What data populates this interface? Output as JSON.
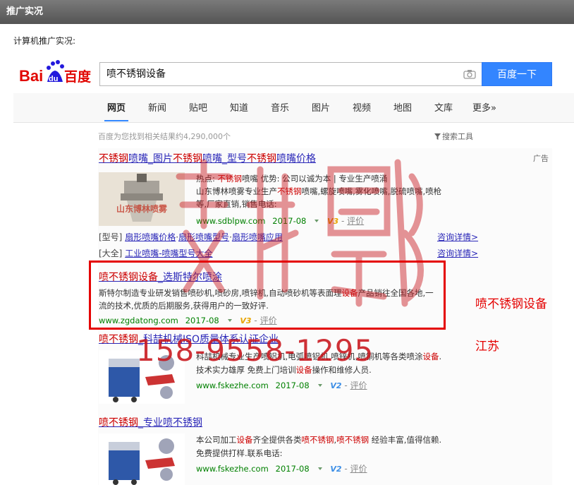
{
  "header": {
    "title": "推广实况"
  },
  "subtitle": "计算机推广实况:",
  "search": {
    "logo": {
      "text1": "Bai",
      "text2": "du",
      "text3": "百度"
    },
    "query": "喷不锈钢设备",
    "button": "百度一下"
  },
  "tabs": [
    "网页",
    "新闻",
    "贴吧",
    "知道",
    "音乐",
    "图片",
    "视频",
    "地图",
    "文库",
    "更多»"
  ],
  "stats": "百度为您找到相关结果约4,290,000个",
  "tools": "搜索工具",
  "ad_tag": "广告",
  "results": [
    {
      "title_parts": [
        "不锈钢",
        "喷嘴_图片",
        "不锈钢",
        "喷嘴_型号",
        "不锈钢",
        "喷嘴价格"
      ],
      "desc1_parts": [
        "热点: ",
        "不锈钢",
        "喷嘴    优势: 公司以诚为本 | 专业生产喷涌"
      ],
      "desc2_parts": [
        "山东博林喷雾专业生产",
        "不锈钢",
        "喷嘴,螺旋喷嘴,雾化喷嘴,脱硫喷嘴,喷枪"
      ],
      "desc3": "等,厂家直销,销售电话:",
      "url": "www.sdblpw.com",
      "date": "2017-08",
      "vlevel": "V3",
      "eval": "评价",
      "thumb_text": "山东博林喷雾"
    },
    {
      "title_parts": [
        "喷不锈钢设备",
        "_选斯特尔喷涂"
      ],
      "desc1_parts": [
        "斯特尔制造专业研发销售喷砂机,喷砂房,喷锌机,自动喷砂机等表面理",
        "设备",
        "产品销往全国各地,一"
      ],
      "desc2": "流的技术,优质的后期服务,获得用户的一致好评.",
      "url": "www.zgdatong.com",
      "date": "2017-08",
      "vlevel": "V3",
      "eval": "评价"
    },
    {
      "title_parts": [
        "喷不锈钢",
        "_科喆机械ISO质量体系认证企业"
      ],
      "desc1_parts": [
        "科喆机械专业生产喷铝机,电弧喷铝机,喷锌机,喷铜机等各类喷涂",
        "设备",
        "."
      ],
      "desc2_parts": [
        "技术实力雄厚 免费上门培训",
        "设备",
        "操作和维修人员."
      ],
      "url": "www.fskezhe.com",
      "date": "2017-08",
      "vlevel": "V2",
      "eval": "评价"
    },
    {
      "title_parts": [
        "喷不锈钢",
        "_专业喷不锈钢"
      ],
      "desc1_parts": [
        "本公司加工",
        "设备",
        "齐全提供各类",
        "喷不锈钢",
        ",",
        "喷不锈钢",
        " 经验丰富,值得信赖."
      ],
      "desc2": "免费提供打样.联系电话:",
      "url": "www.fskezhe.com",
      "date": "2017-08",
      "vlevel": "V2",
      "eval": "评价"
    }
  ],
  "sub_links": [
    {
      "bracket": "[型号]",
      "links": [
        "扇形喷嘴价格",
        "扇形喷嘴型号",
        "扇形喷嘴应用"
      ],
      "more": "咨询详情>"
    },
    {
      "bracket": "[大全]",
      "links": [
        "工业喷嘴-喷嘴型号大全"
      ],
      "more": "咨询详情>"
    }
  ],
  "overlay": {
    "keyword": "喷不锈钢设备",
    "region": "江苏",
    "phone": "158-9558-1295"
  }
}
